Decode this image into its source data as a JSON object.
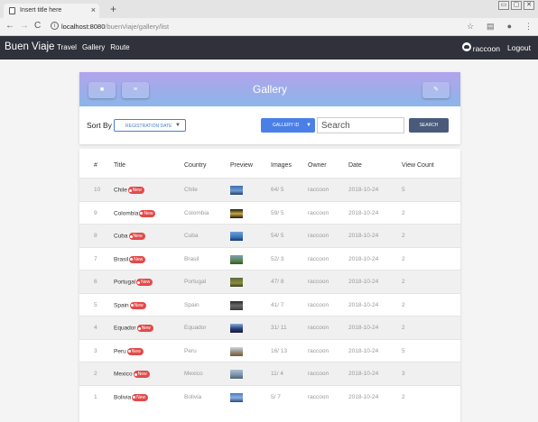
{
  "browser": {
    "tab_title": "Insert title here",
    "tab_close": "×",
    "new_tab": "+",
    "url_host": "localhost:8080",
    "url_path": "/buenViaje/gallery/list",
    "back": "←",
    "forward": "→",
    "reload": "C",
    "info": "i",
    "star": "☆",
    "window_buttons": [
      "▭",
      "▢",
      "✕"
    ]
  },
  "navbar": {
    "brand": "Buen Viaje",
    "links": [
      "Travel",
      "Gallery",
      "Route"
    ],
    "username": "raccoon",
    "logout": "Logout"
  },
  "gallery_card": {
    "title": "Gallery",
    "btn1_icon": "■",
    "btn2_icon": "≡",
    "btn3_icon": "✎",
    "sort_label": "Sort By",
    "sort_value": "REGISTRATION DATE",
    "field_value": "GALLERY ID",
    "search_placeholder": "Search",
    "search_button": "SEARCH"
  },
  "table": {
    "headers": [
      "#",
      "Title",
      "Country",
      "Preview",
      "Images",
      "Owner",
      "Date",
      "View Count"
    ],
    "badge": "New",
    "rows": [
      {
        "num": "10",
        "title": "Chile",
        "country": "Chile",
        "images": "64/ 5",
        "owner": "raccoon",
        "date": "2018-10-24",
        "views": "5"
      },
      {
        "num": "9",
        "title": "Colombia",
        "country": "Colombia",
        "images": "59/ 5",
        "owner": "raccoon",
        "date": "2018-10-24",
        "views": "2"
      },
      {
        "num": "8",
        "title": "Cuba",
        "country": "Cuba",
        "images": "54/ 5",
        "owner": "raccoon",
        "date": "2018-10-24",
        "views": "2"
      },
      {
        "num": "7",
        "title": "Brasil",
        "country": "Brasil",
        "images": "52/ 3",
        "owner": "raccoon",
        "date": "2018-10-24",
        "views": "2"
      },
      {
        "num": "6",
        "title": "Portugal",
        "country": "Portugal",
        "images": "47/ 8",
        "owner": "raccoon",
        "date": "2018-10-24",
        "views": "2"
      },
      {
        "num": "5",
        "title": "Spain",
        "country": "Spain",
        "images": "41/ 7",
        "owner": "raccoon",
        "date": "2018-10-24",
        "views": "2"
      },
      {
        "num": "4",
        "title": "Equador",
        "country": "Equador",
        "images": "31/ 11",
        "owner": "raccoon",
        "date": "2018-10-24",
        "views": "2"
      },
      {
        "num": "3",
        "title": "Peru",
        "country": "Peru",
        "images": "16/ 13",
        "owner": "raccoon",
        "date": "2018-10-24",
        "views": "5"
      },
      {
        "num": "2",
        "title": "Mexico",
        "country": "Mexico",
        "images": "11/ 4",
        "owner": "raccoon",
        "date": "2018-10-24",
        "views": "3"
      },
      {
        "num": "1",
        "title": "Bolivia",
        "country": "Bolivia",
        "images": "5/ 7",
        "owner": "raccoon",
        "date": "2018-10-24",
        "views": "2"
      }
    ]
  },
  "colors": {
    "navbar": "#2f323a",
    "header_top": "#b2a4ec",
    "header_bottom": "#8bb5e8",
    "primary": "#4a7fe8",
    "badge": "#e34a4a"
  }
}
